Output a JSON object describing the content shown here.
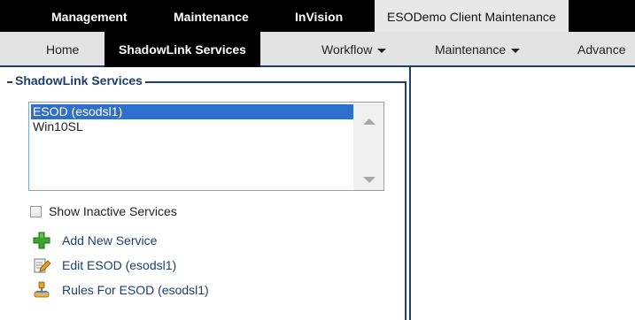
{
  "topnav": {
    "items": [
      {
        "label": "Management"
      },
      {
        "label": "Maintenance"
      },
      {
        "label": "InVision"
      },
      {
        "label": "ESODemo Client Maintenance"
      }
    ]
  },
  "subnav": {
    "items": [
      {
        "label": "Home"
      },
      {
        "label": "ShadowLink Services"
      },
      {
        "label": "Workflow"
      },
      {
        "label": "Maintenance"
      },
      {
        "label": "Advance"
      }
    ]
  },
  "panel": {
    "legend": "ShadowLink Services",
    "services": [
      {
        "label": "ESOD (esodsl1)",
        "selected": true
      },
      {
        "label": "Win10SL",
        "selected": false
      }
    ],
    "show_inactive_label": "Show Inactive Services",
    "show_inactive_checked": false,
    "actions": {
      "add": "Add New Service",
      "edit": "Edit ESOD (esodsl1)",
      "rules": "Rules For ESOD (esodsl1)"
    }
  },
  "colors": {
    "nav_dark": "#000000",
    "subnav_bg": "#e3e3e3",
    "accent": "#1d3f6e",
    "selection": "#2f6fcc"
  },
  "icons": [
    "chevron-up-icon",
    "chevron-down-icon",
    "plus-icon",
    "edit-icon",
    "rules-icon",
    "caret-down-icon"
  ]
}
